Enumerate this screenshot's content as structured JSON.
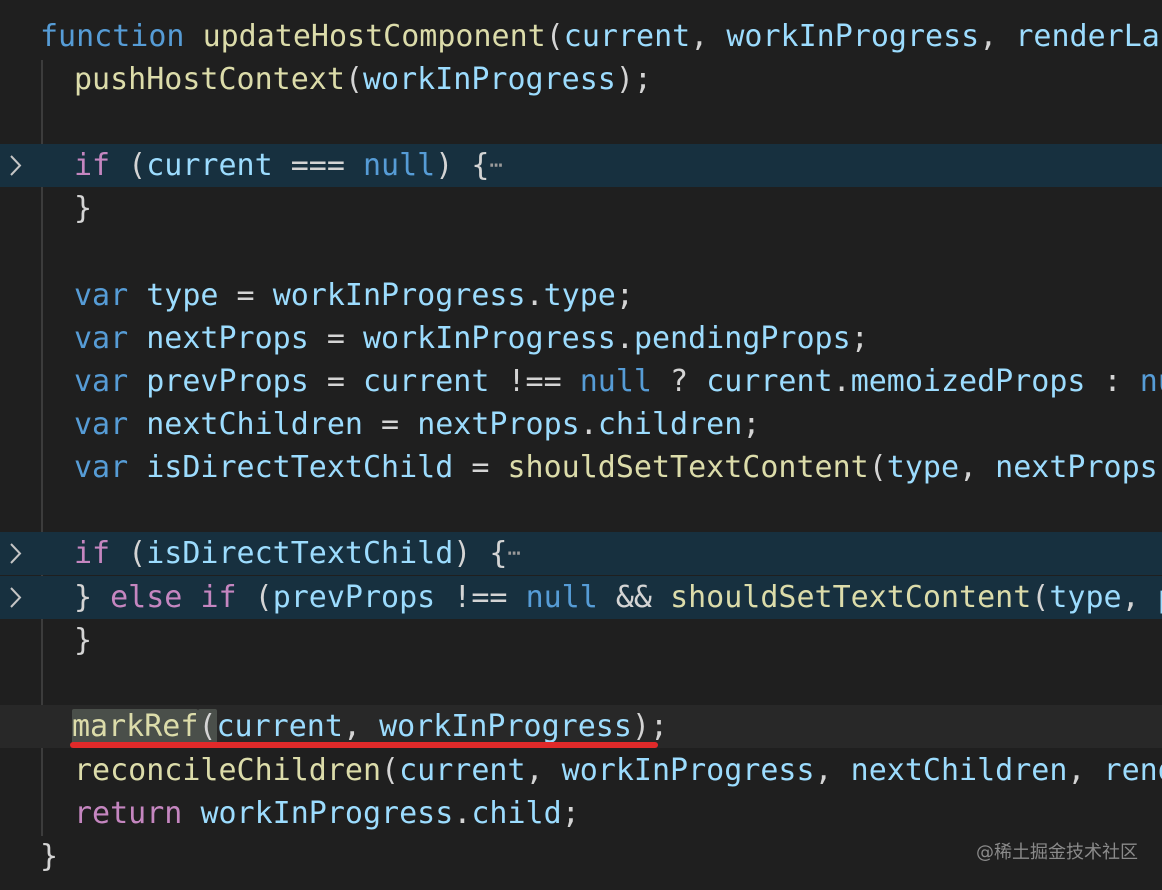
{
  "editor": {
    "theme": {
      "background": "#1f1f1f",
      "folded_line_background": "#17303f",
      "current_line_background": "#282828",
      "keyword": "#569cd6",
      "control": "#c586c0",
      "function": "#dcdcaa",
      "variable": "#9cdcfe",
      "text": "#d4d4d4",
      "annotation_underline": "#e02a2a"
    },
    "lines": [
      {
        "tokens": [
          {
            "t": "function",
            "c": "kw"
          },
          {
            "t": " ",
            "c": "punc"
          },
          {
            "t": "updateHostComponent",
            "c": "fn"
          },
          {
            "t": "(",
            "c": "punc"
          },
          {
            "t": "current",
            "c": "param"
          },
          {
            "t": ", ",
            "c": "punc"
          },
          {
            "t": "workInProgress",
            "c": "param"
          },
          {
            "t": ", ",
            "c": "punc"
          },
          {
            "t": "renderLanes",
            "c": "param"
          }
        ]
      },
      {
        "tokens": [
          {
            "t": "pushHostContext",
            "c": "fn"
          },
          {
            "t": "(",
            "c": "punc"
          },
          {
            "t": "workInProgress",
            "c": "var"
          },
          {
            "t": ");",
            "c": "punc"
          }
        ]
      },
      {
        "tokens": []
      },
      {
        "tokens": [
          {
            "t": "if",
            "c": "ctl"
          },
          {
            "t": " (",
            "c": "punc"
          },
          {
            "t": "current",
            "c": "var"
          },
          {
            "t": " === ",
            "c": "op"
          },
          {
            "t": "null",
            "c": "null"
          },
          {
            "t": ") {",
            "c": "punc"
          }
        ],
        "folded": true
      },
      {
        "tokens": [
          {
            "t": "}",
            "c": "punc"
          }
        ]
      },
      {
        "tokens": []
      },
      {
        "tokens": [
          {
            "t": "var",
            "c": "kw"
          },
          {
            "t": " ",
            "c": "punc"
          },
          {
            "t": "type",
            "c": "var"
          },
          {
            "t": " = ",
            "c": "op"
          },
          {
            "t": "workInProgress",
            "c": "var"
          },
          {
            "t": ".",
            "c": "punc"
          },
          {
            "t": "type",
            "c": "prop"
          },
          {
            "t": ";",
            "c": "punc"
          }
        ]
      },
      {
        "tokens": [
          {
            "t": "var",
            "c": "kw"
          },
          {
            "t": " ",
            "c": "punc"
          },
          {
            "t": "nextProps",
            "c": "var"
          },
          {
            "t": " = ",
            "c": "op"
          },
          {
            "t": "workInProgress",
            "c": "var"
          },
          {
            "t": ".",
            "c": "punc"
          },
          {
            "t": "pendingProps",
            "c": "prop"
          },
          {
            "t": ";",
            "c": "punc"
          }
        ]
      },
      {
        "tokens": [
          {
            "t": "var",
            "c": "kw"
          },
          {
            "t": " ",
            "c": "punc"
          },
          {
            "t": "prevProps",
            "c": "var"
          },
          {
            "t": " = ",
            "c": "op"
          },
          {
            "t": "current",
            "c": "var"
          },
          {
            "t": " !== ",
            "c": "op"
          },
          {
            "t": "null",
            "c": "null"
          },
          {
            "t": " ? ",
            "c": "op"
          },
          {
            "t": "current",
            "c": "var"
          },
          {
            "t": ".",
            "c": "punc"
          },
          {
            "t": "memoizedProps",
            "c": "prop"
          },
          {
            "t": " : ",
            "c": "op"
          },
          {
            "t": "null",
            "c": "null"
          }
        ]
      },
      {
        "tokens": [
          {
            "t": "var",
            "c": "kw"
          },
          {
            "t": " ",
            "c": "punc"
          },
          {
            "t": "nextChildren",
            "c": "var"
          },
          {
            "t": " = ",
            "c": "op"
          },
          {
            "t": "nextProps",
            "c": "var"
          },
          {
            "t": ".",
            "c": "punc"
          },
          {
            "t": "children",
            "c": "prop"
          },
          {
            "t": ";",
            "c": "punc"
          }
        ]
      },
      {
        "tokens": [
          {
            "t": "var",
            "c": "kw"
          },
          {
            "t": " ",
            "c": "punc"
          },
          {
            "t": "isDirectTextChild",
            "c": "var"
          },
          {
            "t": " = ",
            "c": "op"
          },
          {
            "t": "shouldSetTextContent",
            "c": "fn"
          },
          {
            "t": "(",
            "c": "punc"
          },
          {
            "t": "type",
            "c": "var"
          },
          {
            "t": ", ",
            "c": "punc"
          },
          {
            "t": "nextProps",
            "c": "var"
          },
          {
            "t": ");",
            "c": "punc"
          }
        ]
      },
      {
        "tokens": []
      },
      {
        "tokens": [
          {
            "t": "if",
            "c": "ctl"
          },
          {
            "t": " (",
            "c": "punc"
          },
          {
            "t": "isDirectTextChild",
            "c": "var"
          },
          {
            "t": ") {",
            "c": "punc"
          }
        ],
        "folded": true
      },
      {
        "tokens": [
          {
            "t": "} ",
            "c": "punc"
          },
          {
            "t": "else",
            "c": "ctl"
          },
          {
            "t": " ",
            "c": "punc"
          },
          {
            "t": "if",
            "c": "ctl"
          },
          {
            "t": " (",
            "c": "punc"
          },
          {
            "t": "prevProps",
            "c": "var"
          },
          {
            "t": " !== ",
            "c": "op"
          },
          {
            "t": "null",
            "c": "null"
          },
          {
            "t": " && ",
            "c": "op"
          },
          {
            "t": "shouldSetTextContent",
            "c": "fn"
          },
          {
            "t": "(",
            "c": "punc"
          },
          {
            "t": "type",
            "c": "var"
          },
          {
            "t": ", ",
            "c": "punc"
          },
          {
            "t": "pre",
            "c": "var"
          }
        ],
        "folded": true,
        "no_ellipsis": true
      },
      {
        "tokens": [
          {
            "t": "}",
            "c": "punc"
          }
        ]
      },
      {
        "tokens": []
      },
      {
        "tokens": [
          {
            "t": "markRef",
            "c": "fn",
            "hl": true
          },
          {
            "t": "(",
            "c": "punc",
            "hl": true
          },
          {
            "t": "current",
            "c": "var"
          },
          {
            "t": ", ",
            "c": "punc"
          },
          {
            "t": "workInProgress",
            "c": "var"
          },
          {
            "t": ");",
            "c": "punc"
          }
        ],
        "current": true,
        "underlined": true
      },
      {
        "tokens": [
          {
            "t": "reconcileChildren",
            "c": "fn"
          },
          {
            "t": "(",
            "c": "punc"
          },
          {
            "t": "current",
            "c": "var"
          },
          {
            "t": ", ",
            "c": "punc"
          },
          {
            "t": "workInProgress",
            "c": "var"
          },
          {
            "t": ", ",
            "c": "punc"
          },
          {
            "t": "nextChildren",
            "c": "var"
          },
          {
            "t": ", ",
            "c": "punc"
          },
          {
            "t": "render",
            "c": "var"
          }
        ]
      },
      {
        "tokens": [
          {
            "t": "return",
            "c": "ctl"
          },
          {
            "t": " ",
            "c": "punc"
          },
          {
            "t": "workInProgress",
            "c": "var"
          },
          {
            "t": ".",
            "c": "punc"
          },
          {
            "t": "child",
            "c": "prop"
          },
          {
            "t": ";",
            "c": "punc"
          }
        ]
      },
      {
        "tokens": [
          {
            "t": "}",
            "c": "punc"
          }
        ]
      }
    ],
    "fold_icon": "chevron-right-icon",
    "ellipsis_glyph": "⋯"
  },
  "watermark": {
    "text": "@稀土掘金技术社区"
  }
}
